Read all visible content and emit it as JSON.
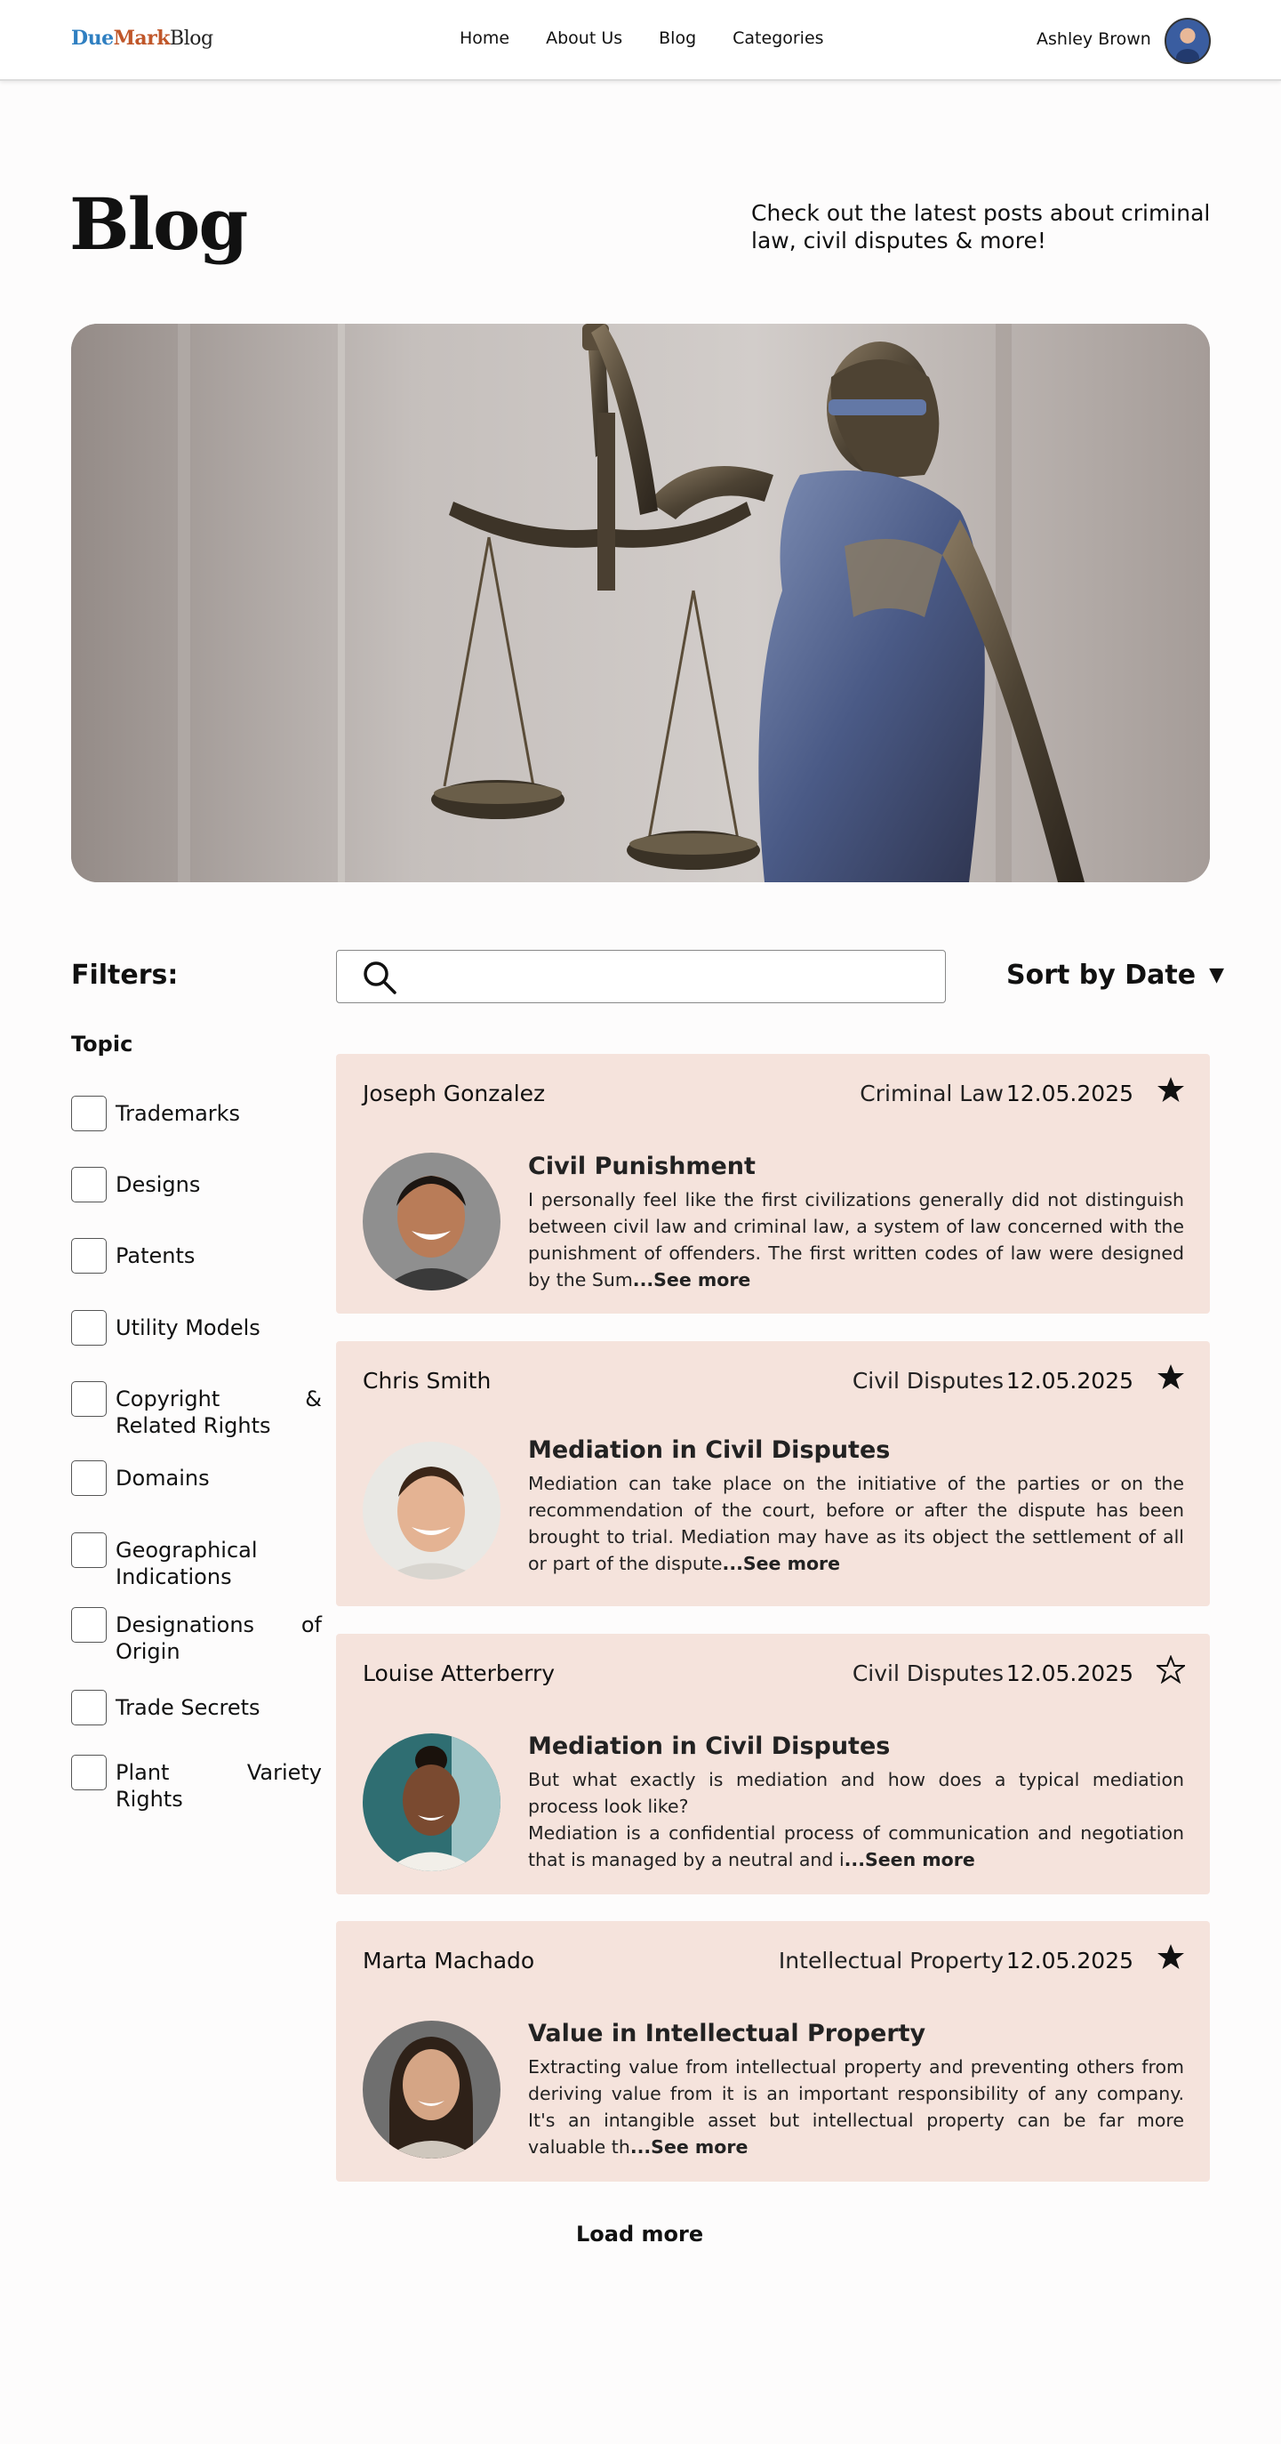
{
  "nav": {
    "logo": {
      "part1": "Due",
      "part2": "Mark",
      "part3": "Blog"
    },
    "items": [
      {
        "label": "Home"
      },
      {
        "label": "About Us"
      },
      {
        "label": "Blog"
      },
      {
        "label": "Categories"
      }
    ],
    "user_name": "Ashley Brown"
  },
  "hero": {
    "title": "Blog",
    "tagline": "Check out the latest posts about criminal law, civil disputes & more!"
  },
  "filters": {
    "title": "Filters:",
    "topic_title": "Topic",
    "items": [
      {
        "label": "Trademarks"
      },
      {
        "label": "Designs"
      },
      {
        "label": "Patents"
      },
      {
        "label": "Utility Models"
      },
      {
        "label": "Copyright & Related Rights"
      },
      {
        "label": "Domains"
      },
      {
        "label": "Geographical Indications"
      },
      {
        "label": "Designations of Origin"
      },
      {
        "label": "Trade Secrets"
      },
      {
        "label": "Plant Variety Rights"
      }
    ]
  },
  "search": {
    "value": "",
    "placeholder": "",
    "icon": "search-icon"
  },
  "sort": {
    "label": "Sort by Date",
    "caret": "▼"
  },
  "posts": [
    {
      "author": "Joseph Gonzalez",
      "category": "Criminal Law",
      "date": "12.05.2025",
      "starred": true,
      "title": "Civil Punishment",
      "excerpt": "I personally feel like the first civilizations generally did not distinguish between civil law and criminal law, a system of law concerned with the punishment of offenders. The first written codes of law were designed by the Sum",
      "more": "...See more"
    },
    {
      "author": "Chris Smith",
      "category": "Civil Disputes",
      "date": "12.05.2025",
      "starred": true,
      "title": "Mediation in Civil Disputes",
      "excerpt": "Mediation can take place on the initiative of the parties or on the recommendation of the court, before or after the dispute has been brought to trial. Mediation may have as its object the settlement of all or part of the dispute",
      "more": "...See more"
    },
    {
      "author": "Louise Atterberry",
      "category": "Civil Disputes",
      "date": "12.05.2025",
      "starred": false,
      "title": "Mediation in Civil Disputes",
      "excerpt": "But what exactly is mediation and how does a typical mediation process look like?\nMediation is a confidential process of communication and negotiation that is  managed by a neutral and i",
      "more": "...Seen more"
    },
    {
      "author": "Marta Machado",
      "category": "Intellectual Property",
      "date": "12.05.2025",
      "starred": true,
      "title": "Value in Intellectual Property",
      "excerpt": "Extracting value from intellectual property and preventing others from deriving value from it is an important responsibility of any company.  It's an intangible asset but intellectual property can be far more  valuable th",
      "more": "...See more"
    }
  ],
  "load_more": "Load more",
  "colors": {
    "card_bg": "#f5e3dc",
    "logo_due": "#2f7fc1",
    "logo_mark": "#c0572a"
  }
}
